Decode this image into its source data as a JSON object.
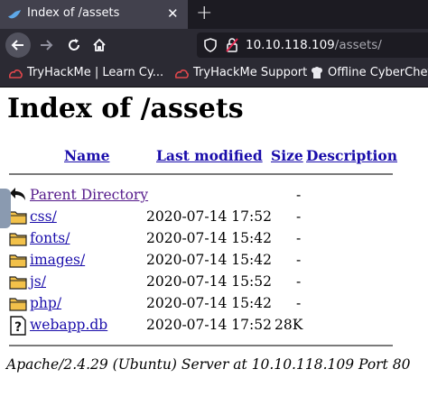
{
  "browser": {
    "tab_title": "Index of /assets",
    "tab_close": "✕",
    "new_tab": "+",
    "url_host": "10.10.118.109",
    "url_path": "/assets/",
    "bookmarks": [
      {
        "label": "TryHackMe | Learn Cy...",
        "icon": "tryhackme-icon"
      },
      {
        "label": "TryHackMe Support",
        "icon": "tryhackme-icon"
      },
      {
        "label": "Offline CyberChef",
        "icon": "chef-icon"
      }
    ]
  },
  "page": {
    "title": "Index of /assets",
    "columns": {
      "name": "Name",
      "modified": "Last modified",
      "size": "Size",
      "description": "Description"
    },
    "rows": [
      {
        "name": "Parent Directory",
        "modified": "",
        "size": "-",
        "icon": "back-arrow-icon"
      },
      {
        "name": "css/",
        "modified": "2020-07-14 17:52",
        "size": "-",
        "icon": "folder-icon"
      },
      {
        "name": "fonts/",
        "modified": "2020-07-14 15:42",
        "size": "-",
        "icon": "folder-icon"
      },
      {
        "name": "images/",
        "modified": "2020-07-14 15:42",
        "size": "-",
        "icon": "folder-icon"
      },
      {
        "name": "js/",
        "modified": "2020-07-14 15:52",
        "size": "-",
        "icon": "folder-icon"
      },
      {
        "name": "php/",
        "modified": "2020-07-14 15:42",
        "size": "-",
        "icon": "folder-icon"
      },
      {
        "name": "webapp.db",
        "modified": "2020-07-14 17:52",
        "size": "28K",
        "icon": "unknown-file-icon"
      }
    ],
    "footer": "Apache/2.4.29 (Ubuntu) Server at 10.10.118.109 Port 80"
  }
}
